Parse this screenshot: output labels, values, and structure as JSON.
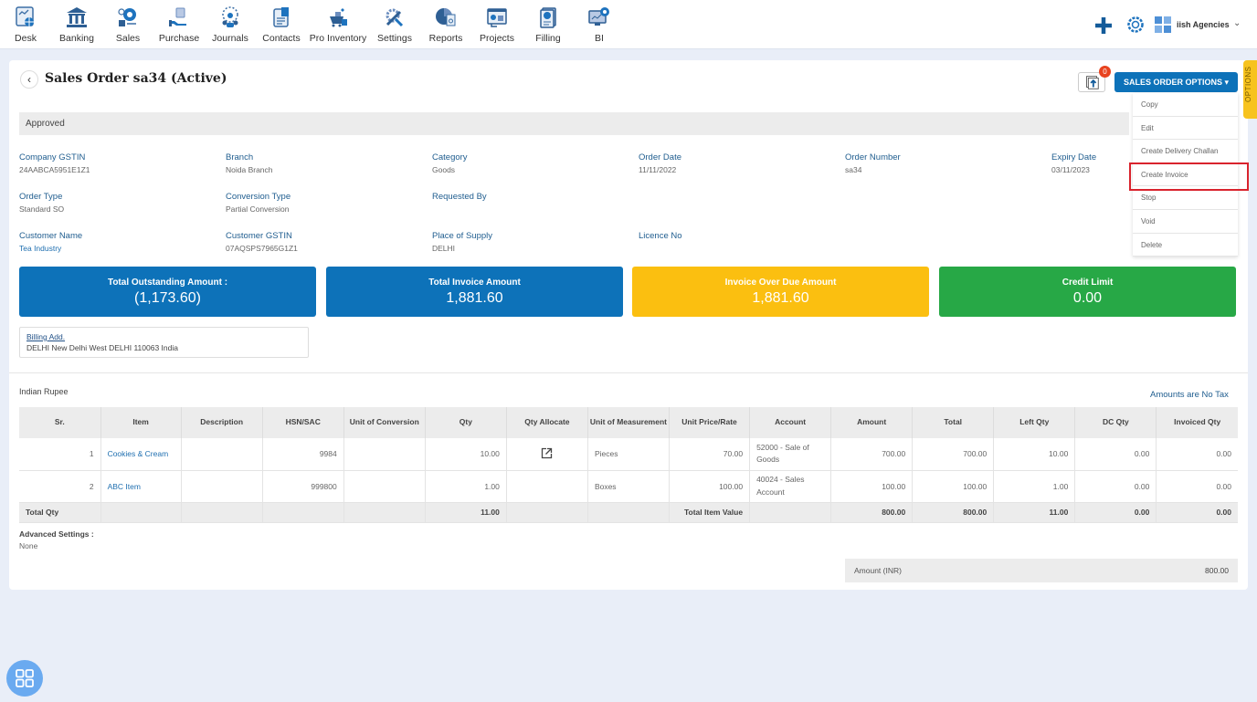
{
  "nav": {
    "items": [
      {
        "label": "Desk",
        "icon": "desk-icon"
      },
      {
        "label": "Banking",
        "icon": "bank-icon"
      },
      {
        "label": "Sales",
        "icon": "sales-icon"
      },
      {
        "label": "Purchase",
        "icon": "purchase-icon"
      },
      {
        "label": "Journals",
        "icon": "journals-icon"
      },
      {
        "label": "Contacts",
        "icon": "contacts-icon"
      },
      {
        "label": "Pro Inventory",
        "icon": "inventory-icon"
      },
      {
        "label": "Settings",
        "icon": "settings-icon"
      },
      {
        "label": "Reports",
        "icon": "reports-icon"
      },
      {
        "label": "Projects",
        "icon": "projects-icon"
      },
      {
        "label": "Filling",
        "icon": "filling-icon"
      },
      {
        "label": "BI",
        "icon": "bi-icon"
      }
    ],
    "company_name": "iish Agencies"
  },
  "header": {
    "title": "Sales Order sa34 (Active)",
    "notification_count": "0",
    "options_button": "SALES ORDER OPTIONS ▾",
    "side_tab": "OPTIONS"
  },
  "dropdown": {
    "items": [
      "Copy",
      "Edit",
      "Create Delivery Challan",
      "Create Invoice",
      "Stop",
      "Void",
      "Delete"
    ],
    "highlighted": "Create Invoice"
  },
  "status": "Approved",
  "fields": {
    "company_gstin": {
      "label": "Company GSTIN",
      "value": "24AABCA5951E1Z1"
    },
    "branch": {
      "label": "Branch",
      "value": "Noida Branch"
    },
    "category": {
      "label": "Category",
      "value": "Goods"
    },
    "order_date": {
      "label": "Order Date",
      "value": "11/11/2022"
    },
    "order_number": {
      "label": "Order Number",
      "value": "sa34"
    },
    "expiry_date": {
      "label": "Expiry Date",
      "value": "03/11/2023"
    },
    "order_type": {
      "label": "Order Type",
      "value": "Standard SO"
    },
    "conversion_type": {
      "label": "Conversion Type",
      "value": "Partial Conversion"
    },
    "requested_by": {
      "label": "Requested By",
      "value": ""
    },
    "customer_name": {
      "label": "Customer Name",
      "value": "Tea Industry"
    },
    "customer_gstin": {
      "label": "Customer GSTIN",
      "value": "07AQSPS7965G1Z1"
    },
    "place_of_supply": {
      "label": "Place of Supply",
      "value": "DELHI"
    },
    "licence_no": {
      "label": "Licence No",
      "value": ""
    }
  },
  "stats": [
    {
      "label": "Total Outstanding Amount :",
      "value": "(1,173.60)",
      "color": "#0d72b9"
    },
    {
      "label": "Total Invoice Amount",
      "value": "1,881.60",
      "color": "#0d72b9"
    },
    {
      "label": "Invoice Over Due Amount",
      "value": "1,881.60",
      "color": "#fbbf10"
    },
    {
      "label": "Credit Limit",
      "value": "0.00",
      "color": "#27a846"
    }
  ],
  "billing": {
    "label": "Billing Add.",
    "value": "DELHI New Delhi West DELHI 110063 India"
  },
  "currency": "Indian Rupee",
  "tax_note": "Amounts are No Tax",
  "table": {
    "headers": [
      "Sr.",
      "Item",
      "Description",
      "HSN/SAC",
      "Unit of Conversion",
      "Qty",
      "Qty Allocate",
      "Unit of Measurement",
      "Unit Price/Rate",
      "Account",
      "Amount",
      "Total",
      "Left Qty",
      "DC Qty",
      "Invoiced Qty"
    ],
    "rows": [
      {
        "sr": "1",
        "item": "Cookies & Cream",
        "description": "",
        "hsn": "9984",
        "uoc": "",
        "qty": "10.00",
        "uom": "Pieces",
        "rate": "70.00",
        "account": "52000 - Sale of Goods",
        "amount": "700.00",
        "total": "700.00",
        "left_qty": "10.00",
        "dc_qty": "0.00",
        "invoiced_qty": "0.00"
      },
      {
        "sr": "2",
        "item": "ABC Item",
        "description": "",
        "hsn": "999800",
        "uoc": "",
        "qty": "1.00",
        "uom": "Boxes",
        "rate": "100.00",
        "account": "40024 - Sales Account",
        "amount": "100.00",
        "total": "100.00",
        "left_qty": "1.00",
        "dc_qty": "0.00",
        "invoiced_qty": "0.00"
      }
    ],
    "totals": {
      "label": "Total Qty",
      "qty": "11.00",
      "value_label": "Total Item Value",
      "amount": "800.00",
      "total": "800.00",
      "left_qty": "11.00",
      "dc_qty": "0.00",
      "invoiced_qty": "0.00"
    }
  },
  "advanced": {
    "label": "Advanced Settings :",
    "value": "None"
  },
  "amount_summary": {
    "label": "Amount (INR)",
    "value": "800.00"
  }
}
